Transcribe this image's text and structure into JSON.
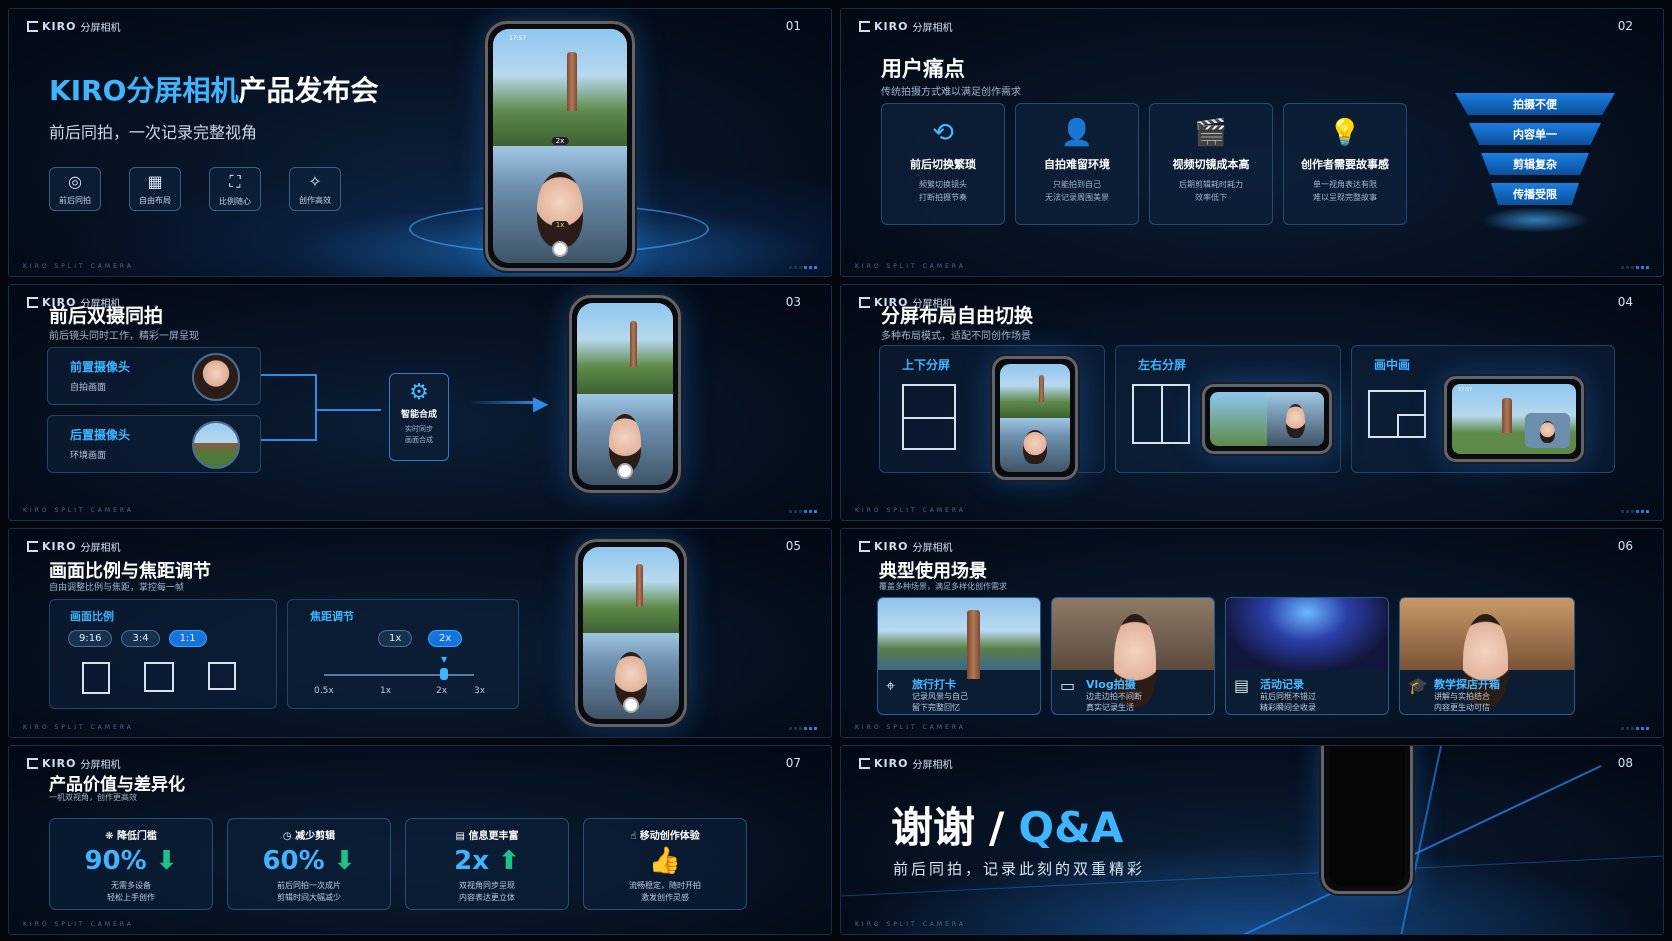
{
  "brand": {
    "name": "KIRO",
    "sub": "分屏相机",
    "footer": "KIRO SPLIT CAMERA"
  },
  "s1": {
    "num": "01",
    "title_a": "KIRO分屏相机",
    "title_b": "产品发布会",
    "subtitle": "前后同拍，一次记录完整视角",
    "features": [
      {
        "icon": "camera-icon",
        "glyph": "◎",
        "label": "前后同拍"
      },
      {
        "icon": "layout-icon",
        "glyph": "▦",
        "label": "自由布局"
      },
      {
        "icon": "ratio-icon",
        "glyph": "⛶",
        "label": "比例随心"
      },
      {
        "icon": "magic-icon",
        "glyph": "✧",
        "label": "创作高效"
      }
    ],
    "phone": {
      "time": "17:57",
      "zoom_a": "2x",
      "zoom_b": "1x"
    }
  },
  "s2": {
    "num": "02",
    "title": "用户痛点",
    "subtitle": "传统拍摄方式难以满足创作需求",
    "cards": [
      {
        "icon": "switch-icon",
        "glyph": "⟲",
        "title": "前后切换繁琐",
        "d1": "频繁切换镜头",
        "d2": "打断拍摄节奏"
      },
      {
        "icon": "user-icon",
        "glyph": "👤",
        "title": "自拍难留环境",
        "d1": "只能拍到自己",
        "d2": "无法记录周围美景"
      },
      {
        "icon": "clapper-icon",
        "glyph": "🎬",
        "title": "视频切镜成本高",
        "d1": "后期剪辑耗时耗力",
        "d2": "效率低下"
      },
      {
        "icon": "bulb-icon",
        "glyph": "💡",
        "title": "创作者需要故事感",
        "d1": "单一视角表达有限",
        "d2": "难以呈现完整故事"
      }
    ],
    "funnel": [
      "拍摄不便",
      "内容单一",
      "剪辑复杂",
      "传播受限"
    ]
  },
  "s3": {
    "num": "03",
    "title": "前后双摄同拍",
    "subtitle": "前后镜头同时工作，精彩一屏呈现",
    "front": {
      "title": "前置摄像头",
      "desc": "自拍画面"
    },
    "rear": {
      "title": "后置摄像头",
      "desc": "环境画面"
    },
    "merge": {
      "title": "智能合成",
      "d1": "实时同步",
      "d2": "画面合成"
    }
  },
  "s4": {
    "num": "04",
    "title": "分屏布局自由切换",
    "subtitle": "多种布局模式，适配不同创作场景",
    "layouts": [
      "上下分屏",
      "左右分屏",
      "画中画"
    ],
    "time": "17:57"
  },
  "s5": {
    "num": "05",
    "title": "画面比例与焦距调节",
    "subtitle": "自由调整比例与焦距，掌控每一帧",
    "ratio": {
      "title": "画面比例",
      "options": [
        "9:16",
        "3:4",
        "1:1"
      ],
      "selected": "1:1"
    },
    "focal": {
      "title": "焦距调节",
      "buttons": [
        "1x",
        "2x"
      ],
      "selected": "2x",
      "ticks": [
        "0.5x",
        "1x",
        "2x",
        "3x"
      ],
      "value": "2x"
    }
  },
  "s6": {
    "num": "06",
    "title": "典型使用场景",
    "subtitle": "覆盖多种场景，满足多样化创作需求",
    "scenes": [
      {
        "icon": "pin-icon",
        "glyph": "⌖",
        "title": "旅行打卡",
        "d1": "记录风景与自己",
        "d2": "留下完整回忆"
      },
      {
        "icon": "video-icon",
        "glyph": "▭",
        "title": "Vlog拍摄",
        "d1": "边走边拍不间断",
        "d2": "真实记录生活"
      },
      {
        "icon": "calendar-icon",
        "glyph": "▤",
        "title": "活动记录",
        "d1": "前后同框不错过",
        "d2": "精彩瞬间全收录"
      },
      {
        "icon": "cap-icon",
        "glyph": "🎓",
        "title": "教学探店开箱",
        "d1": "讲解与实拍结合",
        "d2": "内容更生动可信"
      }
    ]
  },
  "s7": {
    "num": "07",
    "title": "产品价值与差异化",
    "subtitle": "一机双视角，创作更高效",
    "stats": [
      {
        "icon": "puzzle-icon",
        "glyph": "❋",
        "head": "降低门槛",
        "value": "90%",
        "arrow": "⬇",
        "d1": "无需多设备",
        "d2": "轻松上手创作"
      },
      {
        "icon": "clock-icon",
        "glyph": "◷",
        "head": "减少剪辑",
        "value": "60%",
        "arrow": "⬇",
        "d1": "前后同拍一次成片",
        "d2": "剪辑时间大幅减少"
      },
      {
        "icon": "doc-icon",
        "glyph": "▤",
        "head": "信息更丰富",
        "value": "2x",
        "arrow": "⬆",
        "d1": "双视角同步呈现",
        "d2": "内容表达更立体"
      },
      {
        "icon": "thumb-icon",
        "glyph": "👍",
        "head": "移动创作体验",
        "value": "",
        "arrow": "",
        "d1": "流畅稳定，随时开拍",
        "d2": "激发创作灵感"
      }
    ]
  },
  "s8": {
    "num": "08",
    "thanks": "谢谢",
    "slash": "/",
    "qa": "Q&A",
    "subtitle": "前后同拍，记录此刻的双重精彩"
  },
  "colors": {
    "accent": "#3fb4ff",
    "bg": "#061121"
  }
}
